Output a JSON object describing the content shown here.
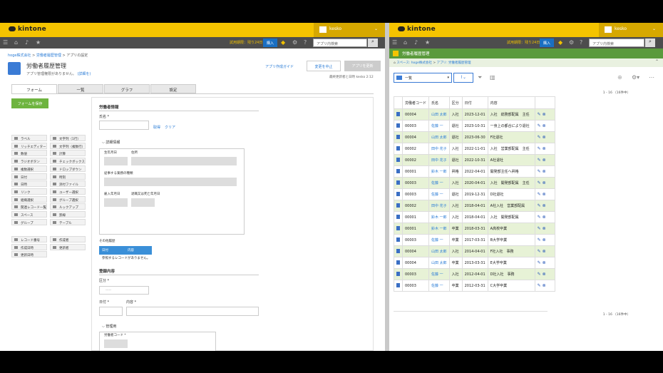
{
  "left": {
    "brand": "kintone",
    "user": "kesko",
    "trial": "試用期限：残り24日",
    "buy": "購入",
    "search_placeholder": "アプリ内検索",
    "breadcrumb": [
      "hoge株式会社",
      "労働者履歴管理",
      "アプリの設定"
    ],
    "app_title": "労働者履歴管理",
    "app_note": "アプリ管理権限がありません。",
    "app_note_link": "(詳細を)",
    "guide_link": "アプリ作成ガイド",
    "cancel_button": "変更を中止",
    "update_button": "アプリを更新",
    "modified": "最終更新者と日時",
    "modified_by": "kesko",
    "modified_time": "2:12",
    "tabs": [
      "フォーム",
      "一覧",
      "グラフ",
      "設定"
    ],
    "save_form_button": "フォームを保存",
    "palette": [
      [
        "ラベル",
        "文字列（1行）"
      ],
      [
        "リッチエディター",
        "文字列（複数行）"
      ],
      [
        "数値",
        "計算"
      ],
      [
        "ラジオボタン",
        "チェックボックス"
      ],
      [
        "複数選択",
        "ドロップダウン"
      ],
      [
        "日付",
        "時刻"
      ],
      [
        "日時",
        "添付ファイル"
      ],
      [
        "リンク",
        "ユーザー選択"
      ],
      [
        "組織選択",
        "グループ選択"
      ],
      [
        "関連レコード一覧",
        "ルックアップ"
      ],
      [
        "スペース",
        "罫線"
      ],
      [
        "グループ",
        "テーブル"
      ]
    ],
    "palette2": [
      [
        "レコード番号",
        "作成者"
      ],
      [
        "作成日時",
        "更新者"
      ],
      [
        "更新日時",
        ""
      ]
    ],
    "form": {
      "section1": "労働者情報",
      "name_label": "氏名 *",
      "search_link": "取得",
      "clear_link": "クリア",
      "detail_group": "詳細情報",
      "birth_label": "生年月日",
      "address_label": "住所",
      "job_label": "従事する業務の種類",
      "hire_label": "雇入年月日",
      "leave_label": "退職又は死亡年月日",
      "other_history": "その他履歴",
      "table_headers": [
        "日付",
        "内容"
      ],
      "table_empty": "参照するレコードがありません。",
      "section2": "登録内容",
      "category_label": "区分 *",
      "category_value": "-----",
      "date_label": "日付 *",
      "content_label": "内容 *",
      "admin_group": "管理用",
      "worker_code_label": "労働者コード *"
    }
  },
  "right": {
    "brand": "kintone",
    "user": "kesko",
    "trial": "試用期限：残り24日",
    "buy": "購入",
    "search_placeholder": "アプリ内検索",
    "app_title": "労働者履歴管理",
    "breadcrumb": [
      "スペース: hoge株式会社",
      "アプリ: 労働者履歴管理"
    ],
    "view_select": "一覧",
    "pager_top": "1 - 16 （16件中）",
    "pager_bottom": "1 - 16 （16件中）",
    "columns": [
      "労働者コード",
      "氏名",
      "区分",
      "日付",
      "内容"
    ],
    "rows": [
      [
        "00004",
        "山田 太郎",
        "入社",
        "2023-12-01",
        "入社　総務部配属　主任"
      ],
      [
        "00003",
        "佐藤 一",
        "退社",
        "2023-10-31",
        "一身上の都合により退社"
      ],
      [
        "00004",
        "山田 太郎",
        "退社",
        "2023-06-30",
        "F社退社"
      ],
      [
        "00002",
        "田中 花子",
        "入社",
        "2022-11-01",
        "入社　営業部配属　主任"
      ],
      [
        "00002",
        "田中 花子",
        "退社",
        "2022-10-31",
        "A社退社"
      ],
      [
        "00001",
        "鈴木 一郎",
        "昇格",
        "2022-04-01",
        "開発部主任へ昇格"
      ],
      [
        "00003",
        "佐藤 一",
        "入社",
        "2020-04-01",
        "入社　開発部配属　主任"
      ],
      [
        "00003",
        "佐藤 一",
        "退社",
        "2019-12-31",
        "D社退社"
      ],
      [
        "00002",
        "田中 花子",
        "入社",
        "2018-04-01",
        "A社入社　営業部配属"
      ],
      [
        "00001",
        "鈴木 一郎",
        "入社",
        "2018-04-01",
        "入社　開発部配属"
      ],
      [
        "00001",
        "鈴木 一郎",
        "卒業",
        "2018-03-31",
        "A高校卒業"
      ],
      [
        "00003",
        "佐藤 一",
        "卒業",
        "2017-03-31",
        "B大学卒業"
      ],
      [
        "00004",
        "山田 太郎",
        "入社",
        "2014-04-01",
        "F社入社　事務"
      ],
      [
        "00004",
        "山田 太郎",
        "卒業",
        "2013-03-31",
        "E大学卒業"
      ],
      [
        "00003",
        "佐藤 一",
        "入社",
        "2012-04-01",
        "D社入社　事務"
      ],
      [
        "00003",
        "佐藤 一",
        "卒業",
        "2012-03-31",
        "C大学卒業"
      ]
    ]
  }
}
